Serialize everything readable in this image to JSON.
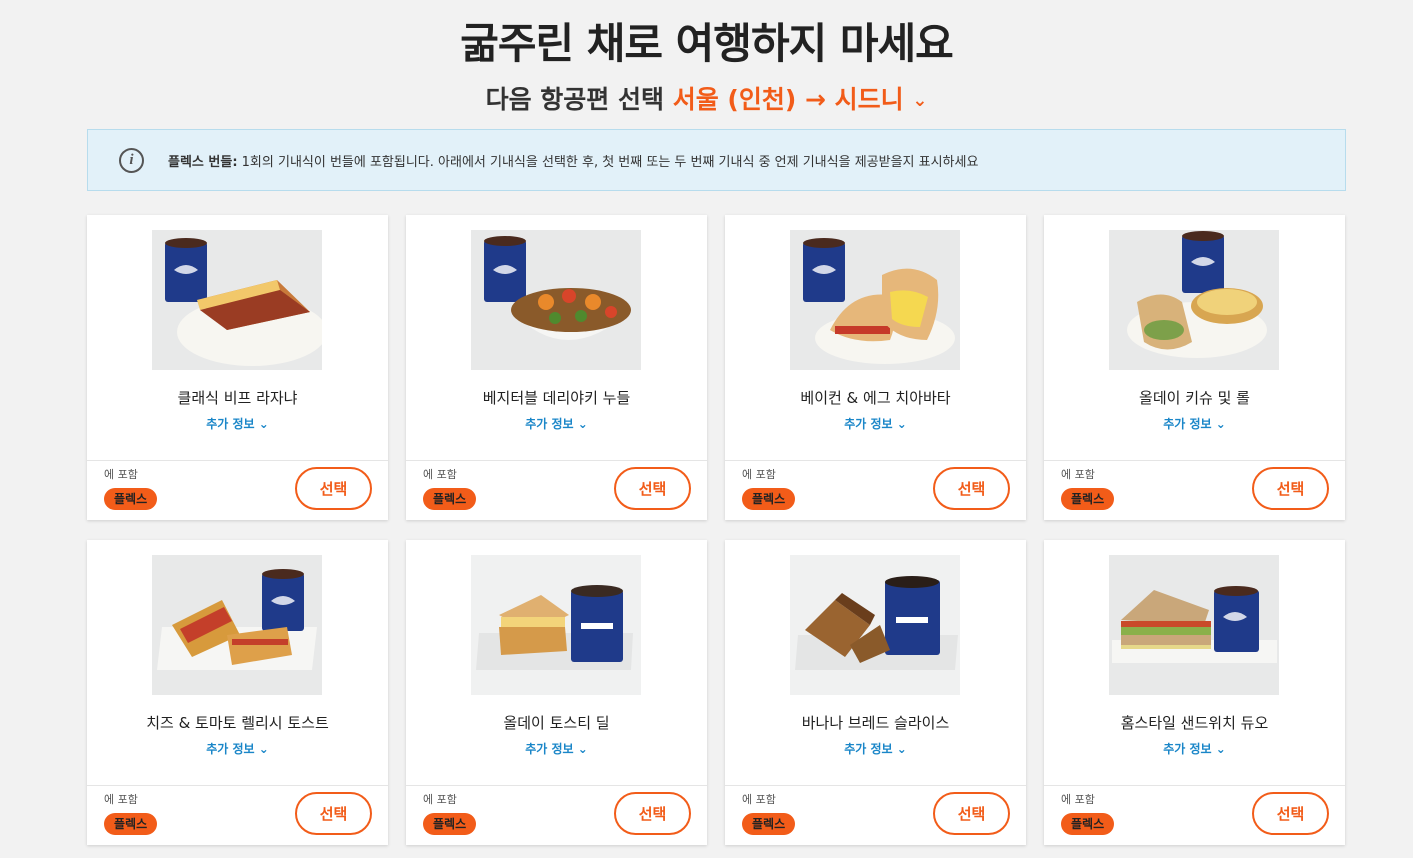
{
  "header": {
    "title": "굶주린 채로 여행하지 마세요",
    "flight_prefix": "다음 항공편 선택",
    "route": "서울 (인천) → 시드니",
    "chevron": "⌄"
  },
  "info": {
    "icon": "info-icon",
    "bold": "플렉스 번들:",
    "text": " 1회의 기내식이 번들에 포함됩니다. 아래에서 기내식을 선택한 후, 첫 번째 또는 두 번째 기내식 중 언제 기내식을 제공받을지 표시하세요"
  },
  "colors": {
    "accent": "#f25c19",
    "link": "#1a86c8",
    "banner_bg": "#e2f1f9"
  },
  "meals": [
    {
      "name": "클래식 비프 라자냐",
      "more": "추가 정보 ⌄",
      "included": "에 포함",
      "badge": "플렉스",
      "select": "선택",
      "kind": "lasagna"
    },
    {
      "name": "베지터블 데리야키 누들",
      "more": "추가 정보 ⌄",
      "included": "에 포함",
      "badge": "플렉스",
      "select": "선택",
      "kind": "noodle"
    },
    {
      "name": "베이컨 & 에그 치아바타",
      "more": "추가 정보 ⌄",
      "included": "에 포함",
      "badge": "플렉스",
      "select": "선택",
      "kind": "ciabatta"
    },
    {
      "name": "올데이 키슈 및 롤",
      "more": "추가 정보 ⌄",
      "included": "에 포함",
      "badge": "플렉스",
      "select": "선택",
      "kind": "quiche"
    },
    {
      "name": "치즈 & 토마토 렐리시 토스트",
      "more": "추가 정보 ⌄",
      "included": "에 포함",
      "badge": "플렉스",
      "select": "선택",
      "kind": "toastie"
    },
    {
      "name": "올데이 토스티 딜",
      "more": "추가 정보 ⌄",
      "included": "에 포함",
      "badge": "플렉스",
      "select": "선택",
      "kind": "toastie2"
    },
    {
      "name": "바나나 브레드 슬라이스",
      "more": "추가 정보 ⌄",
      "included": "에 포함",
      "badge": "플렉스",
      "select": "선택",
      "kind": "bread"
    },
    {
      "name": "홈스타일 샌드위치 듀오",
      "more": "추가 정보 ⌄",
      "included": "에 포함",
      "badge": "플렉스",
      "select": "선택",
      "kind": "sandwich"
    }
  ]
}
